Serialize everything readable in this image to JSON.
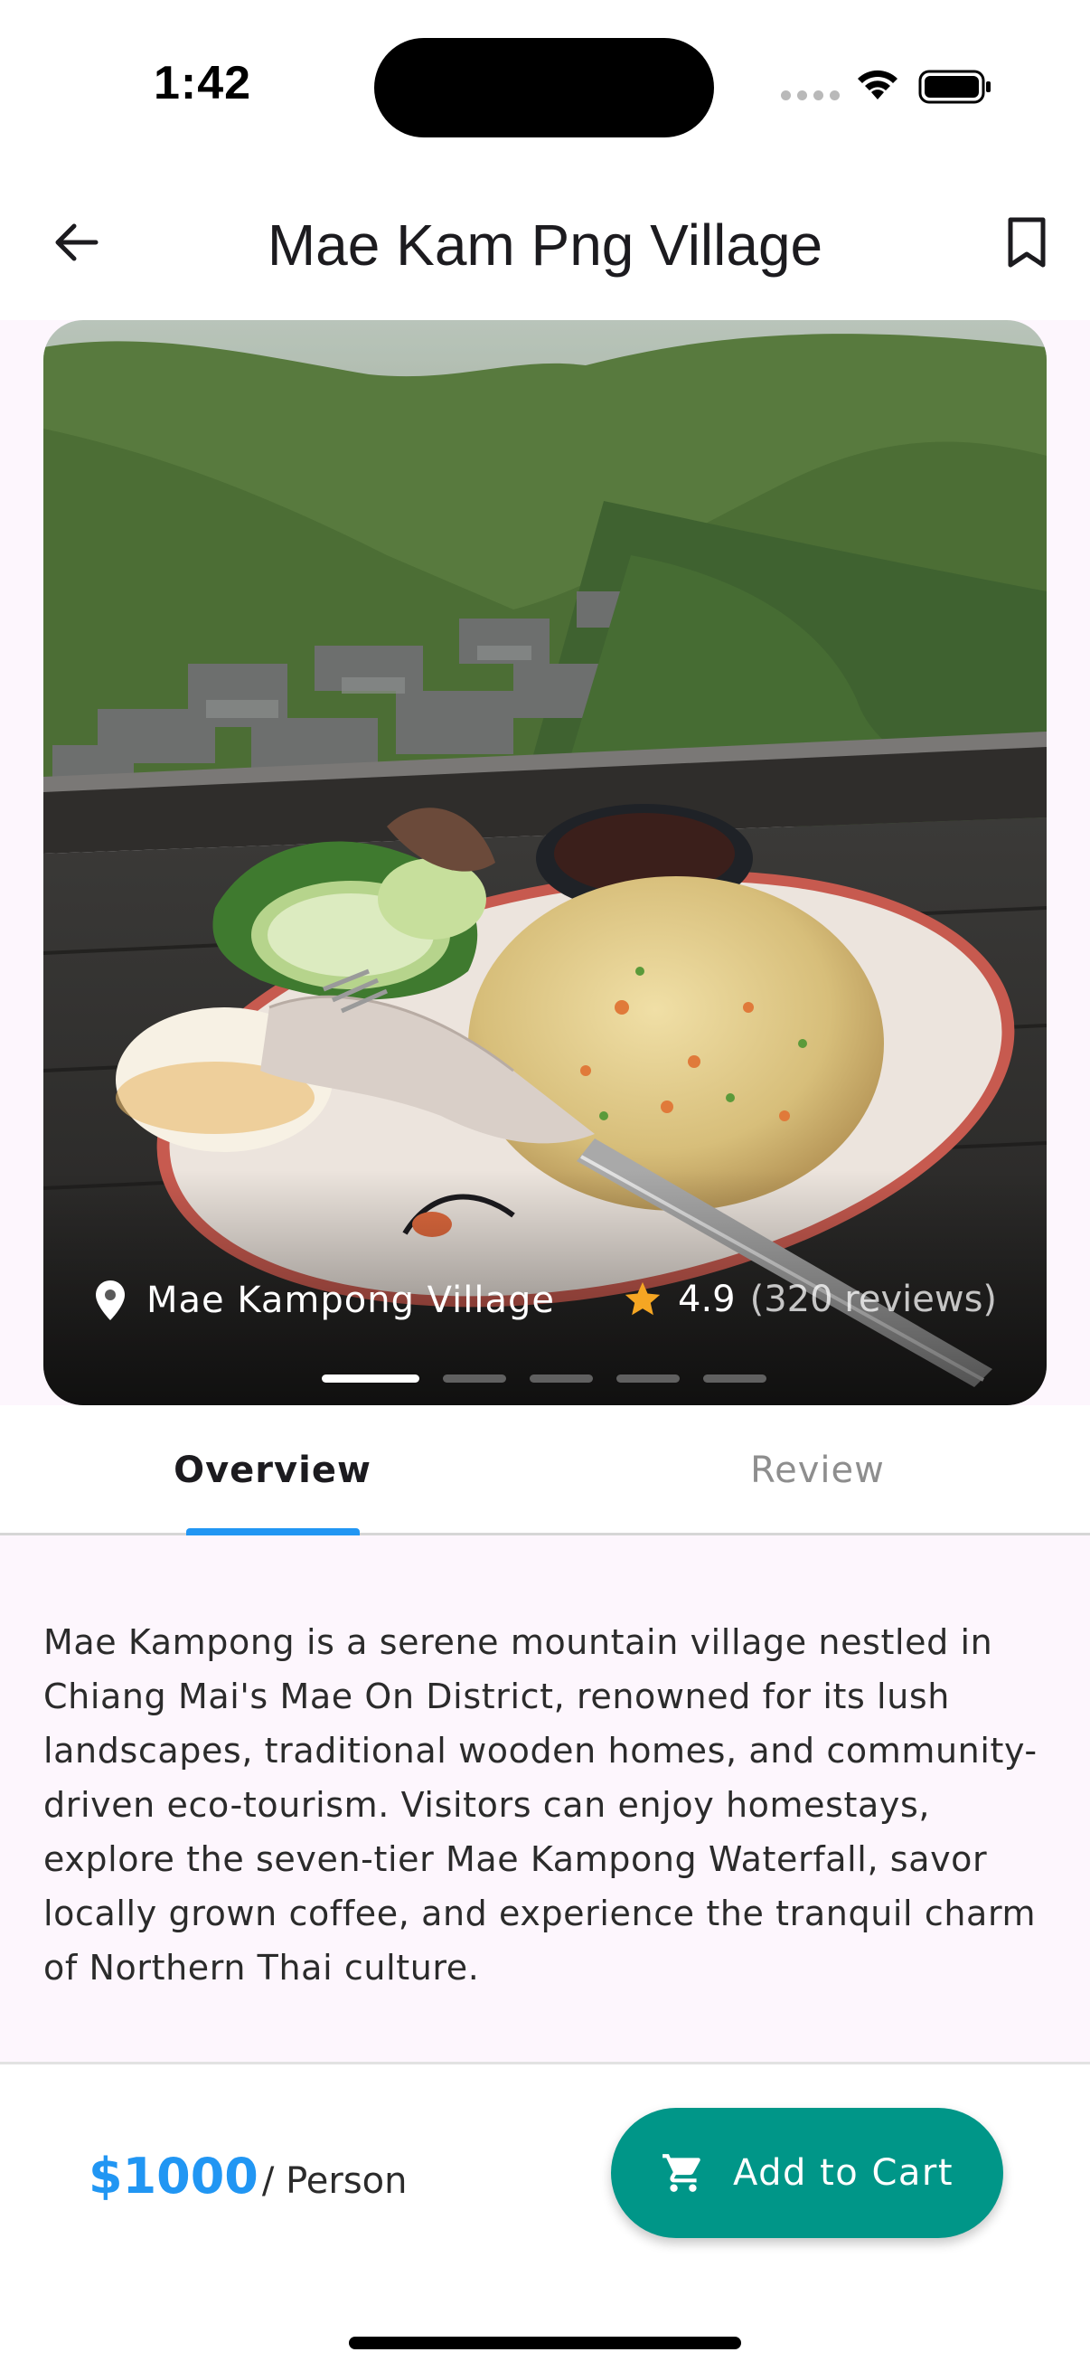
{
  "status_bar": {
    "time": "1:42"
  },
  "app_bar": {
    "title": "Mae Kam Png Village",
    "back_icon": "arrow-left-icon",
    "bookmark_icon": "bookmark-outline-icon"
  },
  "hero": {
    "location": "Mae Kampong Village",
    "location_icon": "location-pin-icon",
    "rating_icon": "star-icon",
    "rating": "4.9",
    "reviews": "(320 reviews)",
    "carousel": {
      "count": 5,
      "active_index": 0
    }
  },
  "tabs": [
    {
      "label": "Overview",
      "active": true
    },
    {
      "label": "Review",
      "active": false
    }
  ],
  "overview": {
    "description": "Mae Kampong is a serene mountain village nestled in Chiang Mai's Mae On District, renowned for its lush landscapes, traditional wooden homes, and community-driven eco-tourism. Visitors can enjoy homestays, explore the seven-tier Mae Kampong Waterfall, savor locally grown coffee, and experience the tranquil charm of Northern Thai culture."
  },
  "booking": {
    "price": "$1000",
    "unit": "/ Person",
    "button_label": "Add to Cart",
    "button_icon": "shopping-cart-icon"
  },
  "colors": {
    "accent_blue": "#2196f3",
    "button_teal": "#009688",
    "star": "#f5a623",
    "page_tint": "#fdf6fd"
  }
}
